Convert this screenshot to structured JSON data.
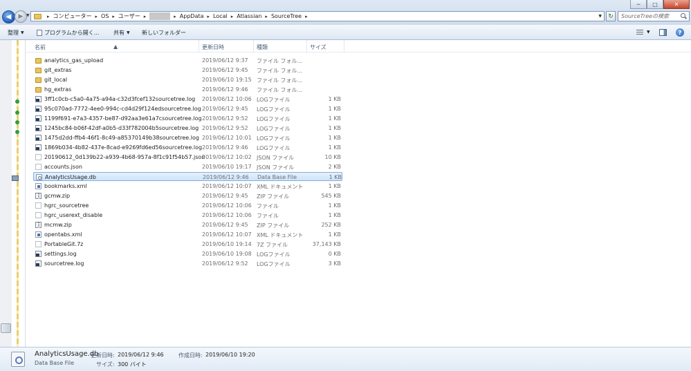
{
  "window": {
    "min_glyph": "─",
    "max_glyph": "□",
    "close_glyph": "✕"
  },
  "address_bar": {
    "crumbs": [
      "コンピューター",
      "OS",
      "ユーザー",
      "",
      "AppData",
      "Local",
      "Atlassian",
      "SourceTree"
    ],
    "search_placeholder": "SourceTreeの検索"
  },
  "toolbar": {
    "organize": "整理",
    "open_with": "プログラムから開く...",
    "share": "共有",
    "new_folder": "新しいフォルダー"
  },
  "columns": {
    "name": "名前",
    "date": "更新日時",
    "type": "種類",
    "size": "サイズ"
  },
  "files": [
    {
      "name": "analytics_gas_upload",
      "date": "2019/06/12 9:37",
      "type": "ファイル フォル...",
      "size": "",
      "icon": "folder-icon"
    },
    {
      "name": "git_extras",
      "date": "2019/06/12 9:45",
      "type": "ファイル フォル...",
      "size": "",
      "icon": "folder-icon"
    },
    {
      "name": "git_local",
      "date": "2019/06/10 19:15",
      "type": "ファイル フォル...",
      "size": "",
      "icon": "folder-icon"
    },
    {
      "name": "hg_extras",
      "date": "2019/06/12 9:46",
      "type": "ファイル フォル...",
      "size": "",
      "icon": "folder-icon"
    },
    {
      "name": "3ff1c0cb-c5a0-4a75-a94a-c32d3fcef132sourcetree.log",
      "date": "2019/06/12 10:06",
      "type": "LOGファイル",
      "size": "1 KB",
      "icon": "log-file-icon"
    },
    {
      "name": "95c070ad-7772-4ee0-994c-cd4d29f124edsourcetree.log",
      "date": "2019/06/12 9:45",
      "type": "LOGファイル",
      "size": "1 KB",
      "icon": "log-file-icon"
    },
    {
      "name": "1199f691-e7a3-4357-be87-d92aa3e61a7csourcetree.log",
      "date": "2019/06/12 9:52",
      "type": "LOGファイル",
      "size": "1 KB",
      "icon": "log-file-icon"
    },
    {
      "name": "1245bc84-b06f-42df-a0b5-d33f782004b5sourcetree.log",
      "date": "2019/06/12 9:52",
      "type": "LOGファイル",
      "size": "1 KB",
      "icon": "log-file-icon"
    },
    {
      "name": "1475d2dd-ffb4-46f1-8c49-a85370149b38sourcetree.log",
      "date": "2019/06/12 10:01",
      "type": "LOGファイル",
      "size": "1 KB",
      "icon": "log-file-icon"
    },
    {
      "name": "1869b034-4b82-437e-8cad-e9269fd6ed56sourcetree.log",
      "date": "2019/06/12 9:46",
      "type": "LOGファイル",
      "size": "1 KB",
      "icon": "log-file-icon"
    },
    {
      "name": "20190612_0d139b22-a939-4b68-957a-8f1c91f54b57.json",
      "date": "2019/06/12 10:02",
      "type": "JSON ファイル",
      "size": "10 KB",
      "icon": "json-file-icon"
    },
    {
      "name": "accounts.json",
      "date": "2019/06/10 19:17",
      "type": "JSON ファイル",
      "size": "2 KB",
      "icon": "json-file-icon"
    },
    {
      "name": "AnalyticsUsage.db",
      "date": "2019/06/12 9:46",
      "type": "Data Base File",
      "size": "1 KB",
      "icon": "database-file-icon",
      "selected": true
    },
    {
      "name": "bookmarks.xml",
      "date": "2019/06/12 10:07",
      "type": "XML ドキュメント",
      "size": "1 KB",
      "icon": "xml-file-icon"
    },
    {
      "name": "gcmw.zip",
      "date": "2019/06/12 9:45",
      "type": "ZIP ファイル",
      "size": "545 KB",
      "icon": "zip-file-icon"
    },
    {
      "name": "hgrc_sourcetree",
      "date": "2019/06/12 10:06",
      "type": "ファイル",
      "size": "1 KB",
      "icon": "file-icon"
    },
    {
      "name": "hgrc_userext_disable",
      "date": "2019/06/12 10:06",
      "type": "ファイル",
      "size": "1 KB",
      "icon": "file-icon"
    },
    {
      "name": "mcmw.zip",
      "date": "2019/06/12 9:45",
      "type": "ZIP ファイル",
      "size": "252 KB",
      "icon": "zip-file-icon"
    },
    {
      "name": "opentabs.xml",
      "date": "2019/06/12 10:07",
      "type": "XML ドキュメント",
      "size": "1 KB",
      "icon": "xml-file-icon"
    },
    {
      "name": "PortableGit.7z",
      "date": "2019/06/10 19:14",
      "type": "7Z ファイル",
      "size": "37,143 KB",
      "icon": "7z-file-icon"
    },
    {
      "name": "settings.log",
      "date": "2019/06/10 19:08",
      "type": "LOGファイル",
      "size": "0 KB",
      "icon": "log-file-icon"
    },
    {
      "name": "sourcetree.log",
      "date": "2019/06/12 9:52",
      "type": "LOGファイル",
      "size": "3 KB",
      "icon": "log-file-icon"
    }
  ],
  "details": {
    "name": "AnalyticsUsage.db",
    "type": "Data Base File",
    "modified_label": "更新日時:",
    "modified_value": "2019/06/12 9:46",
    "created_label": "作成日時:",
    "created_value": "2019/06/10 19:20",
    "size_label": "サイズ:",
    "size_value": "300 バイト"
  },
  "colors": {
    "selection_fill": "#cde4fb",
    "selection_border": "#84acdd",
    "chrome": "#dde7f3"
  }
}
